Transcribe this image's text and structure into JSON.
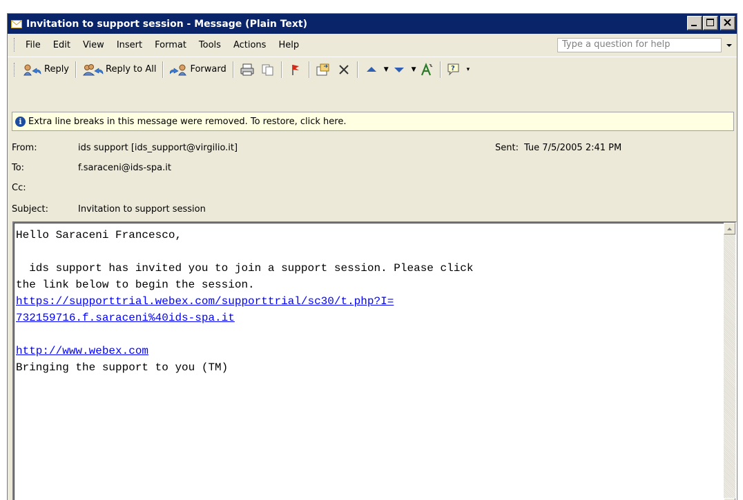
{
  "window": {
    "title": "Invitation to support session - Message (Plain Text)"
  },
  "menubar": {
    "items": [
      "File",
      "Edit",
      "View",
      "Insert",
      "Format",
      "Tools",
      "Actions",
      "Help"
    ],
    "help_placeholder": "Type a question for help"
  },
  "toolbar": {
    "reply_label": "Reply",
    "reply_all_label": "Reply to All",
    "forward_label": "Forward",
    "icons": [
      "print-icon",
      "copy-icon",
      "flag-icon",
      "move-to-folder-icon",
      "delete-icon",
      "previous-item-icon",
      "next-item-icon",
      "address-book-icon",
      "help-icon"
    ]
  },
  "infobar": {
    "text": "Extra line breaks in this message were removed. To restore, click here."
  },
  "header": {
    "from_label": "From:",
    "from_value": "ids support [ids_support@virgilio.it]",
    "sent_label": "Sent:",
    "sent_value": "Tue 7/5/2005 2:41 PM",
    "to_label": "To:",
    "to_value": "f.saraceni@ids-spa.it",
    "cc_label": "Cc:",
    "cc_value": "",
    "subject_label": "Subject:",
    "subject_value": "Invitation to support session"
  },
  "message": {
    "greeting": "Hello Saraceni Francesco,",
    "line1": "  ids support has invited you to join a support session. Please click",
    "line2": "the link below to begin the session.",
    "link1_part1": "https://supporttrial.webex.com/supporttrial/sc30/t.php?I=",
    "link1_part2": "732159716.f.saraceni%40ids-spa.it",
    "link2": "http://www.webex.com",
    "signature": "Bringing the support to you (TM)"
  },
  "colors": {
    "titlebar": "#0a246a",
    "chrome": "#ece9d8",
    "infobar": "#ffffe1",
    "link": "#0000ff"
  }
}
